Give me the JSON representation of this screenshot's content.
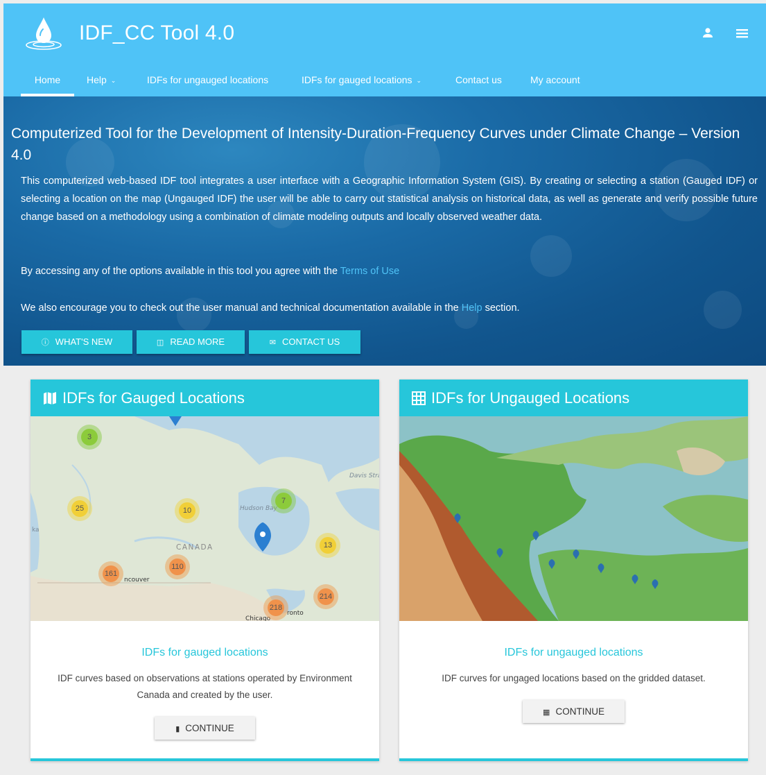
{
  "app": {
    "title": "IDF_CC Tool 4.0"
  },
  "header_icons": {
    "user": "user-icon",
    "menu": "hamburger-menu-icon"
  },
  "nav": {
    "items": [
      {
        "label": "Home",
        "active": true
      },
      {
        "label": "Help",
        "dropdown": true
      },
      {
        "label": "IDFs for ungauged locations"
      },
      {
        "label": "IDFs for gauged locations",
        "dropdown": true
      },
      {
        "label": "Contact us"
      },
      {
        "label": "My account"
      }
    ]
  },
  "hero": {
    "title": "Computerized Tool for the Development of Intensity-Duration-Frequency Curves under Climate Change – Version 4.0",
    "intro": "This computerized web-based IDF tool integrates a user interface with a Geographic Information System (GIS). By creating or selecting a station (Gauged IDF) or selecting a location on the map (Ungauged IDF) the user will be able to carry out statistical analysis on historical data, as well as generate and verify possible future change based on a methodology using a combination of climate modeling outputs and locally observed weather data.",
    "terms_prefix": "By accessing any of the options available in this tool you agree with the ",
    "terms_link": "Terms of Use",
    "manual_prefix": "We also encourage you to check out the user manual and technical documentation available in the ",
    "manual_link": "Help",
    "manual_suffix": " section.",
    "buttons": [
      {
        "label": "WHAT'S NEW",
        "icon": "info-icon"
      },
      {
        "label": "READ MORE",
        "icon": "library-icon"
      },
      {
        "label": "CONTACT US",
        "icon": "mail-icon"
      }
    ]
  },
  "cards": [
    {
      "title": "IDFs for Gauged Locations",
      "icon": "map-icon",
      "link": "IDFs for gauged locations",
      "description": "IDF curves based on observations at stations operated by Environment Canada and created by the user.",
      "button": "CONTINUE",
      "map": {
        "labels": [
          "Davis Strait",
          "Hudson Bay",
          "CANADA",
          "ncouver",
          "ronto",
          "Chicago",
          "ka"
        ],
        "clusters": [
          "3",
          "25",
          "10",
          "7",
          "13",
          "110",
          "161",
          "214",
          "218"
        ]
      }
    },
    {
      "title": "IDFs for Ungauged Locations",
      "icon": "grid-icon",
      "link": "IDFs for ungauged locations",
      "description": "IDF curves for ungaged locations based on the gridded dataset.",
      "button": "CONTINUE"
    }
  ],
  "colors": {
    "header": "#4fc3f7",
    "accent": "#26c6da",
    "link": "#4fc3f7",
    "hero": "#1a6aa6"
  }
}
